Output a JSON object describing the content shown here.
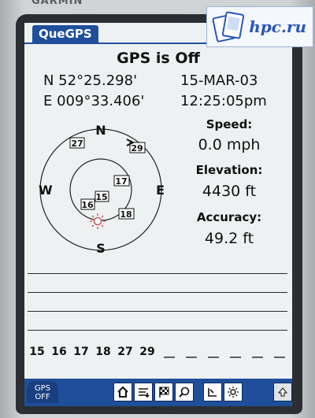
{
  "device": {
    "brand": "GARMIN"
  },
  "watermark": {
    "text": "hpc.ru"
  },
  "app": {
    "title": "QueGPS"
  },
  "gps": {
    "status": "GPS is Off",
    "lat": "N  52°25.298'",
    "lon": "E 009°33.406'",
    "date": "15-MAR-03",
    "time": "12:25:05pm"
  },
  "metrics": {
    "speed_label": "Speed:",
    "speed_value": "0.0 mph",
    "elevation_label": "Elevation:",
    "elevation_value": "4430 ft",
    "accuracy_label": "Accuracy:",
    "accuracy_value": "49.2 ft"
  },
  "skyplot": {
    "north": "N",
    "south": "S",
    "east": "E",
    "west": "W",
    "satellites": [
      "27",
      "29",
      "17",
      "15",
      "16",
      "18"
    ]
  },
  "signal_bars": {
    "labels": [
      "15",
      "16",
      "17",
      "18",
      "27",
      "29",
      "__",
      "__",
      "__",
      "__",
      "__",
      "__"
    ]
  },
  "toolbar": {
    "gps_button": "GPS\nOFF",
    "icons": [
      "home-icon",
      "list-icon",
      "flag-icon",
      "search-icon",
      "clock-icon",
      "sun-icon",
      "up-arrow-icon"
    ]
  }
}
